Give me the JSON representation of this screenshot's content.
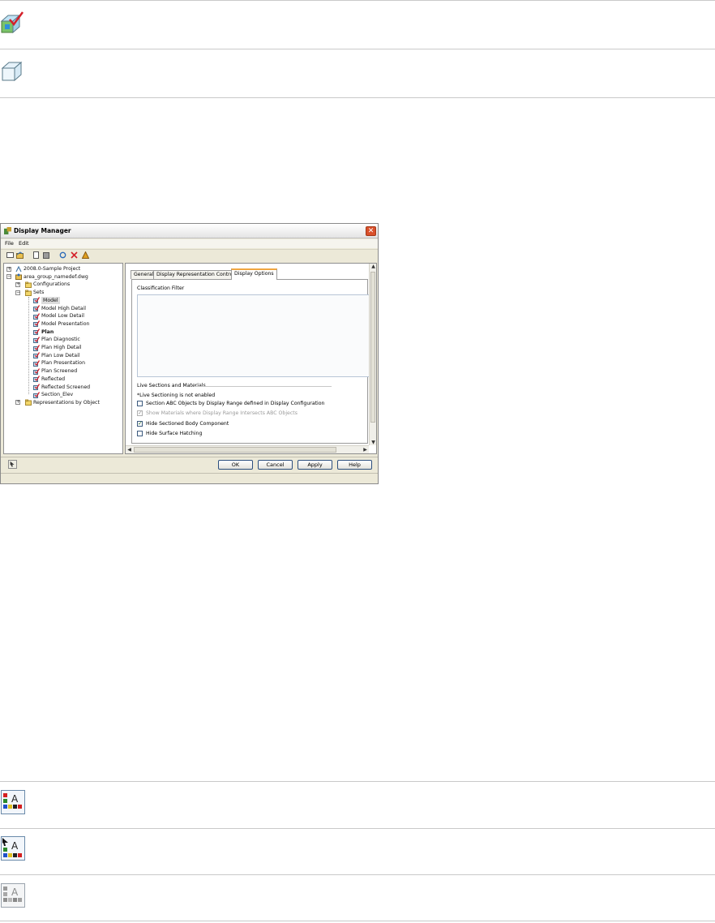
{
  "dialog": {
    "title": "Display Manager",
    "menu": [
      "File",
      "Edit"
    ],
    "tree": [
      {
        "label": "2008.0-Sample Project",
        "level": 0
      },
      {
        "label": "area_group_namedef.dwg",
        "level": 0
      },
      {
        "label": "Configurations",
        "level": 1
      },
      {
        "label": "Sets",
        "level": 1
      },
      {
        "label": "Model",
        "level": 2,
        "selected": true
      },
      {
        "label": "Model High Detail",
        "level": 2
      },
      {
        "label": "Model Low Detail",
        "level": 2
      },
      {
        "label": "Model Presentation",
        "level": 2
      },
      {
        "label": "Plan",
        "level": 2,
        "bold": true
      },
      {
        "label": "Plan Diagnostic",
        "level": 2
      },
      {
        "label": "Plan High Detail",
        "level": 2
      },
      {
        "label": "Plan Low Detail",
        "level": 2
      },
      {
        "label": "Plan Presentation",
        "level": 2
      },
      {
        "label": "Plan Screened",
        "level": 2
      },
      {
        "label": "Reflected",
        "level": 2
      },
      {
        "label": "Reflected Screened",
        "level": 2
      },
      {
        "label": "Section_Elev",
        "level": 2
      },
      {
        "label": "Representations by Object",
        "level": 1
      }
    ],
    "tabs": [
      "General",
      "Display Representation Control",
      "Display Options"
    ],
    "active_tab": "Display Options",
    "classification_filter_label": "Classification Filter",
    "live_sections_label": "Live Sections and Materials",
    "live_note": "*Live Sectioning is not enabled",
    "options": [
      {
        "label": "Section ABC Objects by Display Range defined in Display Configuration",
        "checked": false,
        "disabled": false
      },
      {
        "label": "Show Materials where Display Range Intersects ABC Objects",
        "checked": true,
        "disabled": true
      },
      {
        "label": "Hide Sectioned Body Component",
        "checked": true,
        "disabled": false
      },
      {
        "label": "Hide Surface Hatching",
        "checked": false,
        "disabled": false
      }
    ],
    "buttons": {
      "ok": "OK",
      "cancel": "Cancel",
      "apply": "Apply",
      "help": "Help"
    }
  }
}
